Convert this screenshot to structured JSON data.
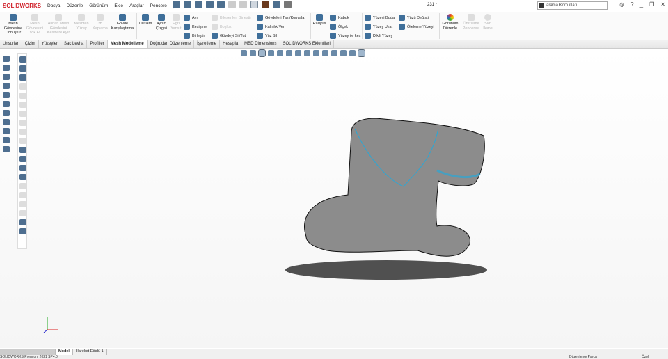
{
  "app": {
    "logo": "SOLIDWORKS",
    "doc_title": "231 *"
  },
  "menu": [
    "Dosya",
    "Düzenle",
    "Görünüm",
    "Ekle",
    "Araçlar",
    "Pencere"
  ],
  "search": {
    "placeholder": "arama Komutları"
  },
  "ribbon": {
    "large": [
      {
        "label": "Mesh Gövdesine Dönüştür",
        "enabled": true
      },
      {
        "label": "Mesh Gövdesini Yok Et",
        "enabled": false
      },
      {
        "label": "Alınan Mesh Gövdesini Kesitlere Ayır",
        "enabled": false
      },
      {
        "label": "Meshten Yüzey",
        "enabled": false
      },
      {
        "label": "3B Kaplama",
        "enabled": false
      },
      {
        "label": "Gövde Karşılaştırma",
        "enabled": true
      },
      {
        "label": "Düzlem",
        "enabled": true
      },
      {
        "label": "Ayrım Çizgisi",
        "enabled": true
      },
      {
        "label": "Eğri Yansıt",
        "enabled": false
      },
      {
        "label": "Radyus",
        "enabled": true
      },
      {
        "label": "Görünüm Düzenle",
        "enabled": true
      },
      {
        "label": "Önizleme Penceresi",
        "enabled": false
      },
      {
        "label": "Son İleme",
        "enabled": false
      }
    ],
    "small": [
      {
        "label": "Ayır",
        "enabled": true
      },
      {
        "label": "Kesişme",
        "enabled": true
      },
      {
        "label": "Birleştir",
        "enabled": true
      },
      {
        "label": "Bileşenleri Birleştir",
        "enabled": false
      },
      {
        "label": "Boşluk",
        "enabled": false
      },
      {
        "label": "Gövdeyi Sil/Tut",
        "enabled": true
      },
      {
        "label": "Gövdeleri Taşı/Kopyala",
        "enabled": true
      },
      {
        "label": "Kalınlık Ver",
        "enabled": true
      },
      {
        "label": "Yüz Sil",
        "enabled": true
      },
      {
        "label": "Kabuk",
        "enabled": true
      },
      {
        "label": "Ölçek",
        "enabled": true
      },
      {
        "label": "Yüzey ile kes",
        "enabled": true
      },
      {
        "label": "Yüzeyi Buda",
        "enabled": true
      },
      {
        "label": "Yüzey Uzat",
        "enabled": true
      },
      {
        "label": "Dikili Yüzey",
        "enabled": true
      },
      {
        "label": "Yüzü Değiştir",
        "enabled": true
      },
      {
        "label": "Öteleme Yüzeyi",
        "enabled": true
      }
    ]
  },
  "tabs": [
    "Unsurlar",
    "Çizim",
    "Yüzeyler",
    "Sac Levha",
    "Profiller",
    "Mesh Modelleme",
    "Doğrudan Düzenleme",
    "İşaretleme",
    "Hesapla",
    "MBD Dimensions",
    "SOLIDWORKS Eklentileri"
  ],
  "active_tab": "Mesh Modelleme",
  "bottom_tabs": [
    "Model",
    "Hareket Etüdü 1"
  ],
  "status": {
    "left": "SOLIDWORKS Premium 2021 SP4.0",
    "mode": "Düzenleme Parça",
    "units": "Özel"
  }
}
